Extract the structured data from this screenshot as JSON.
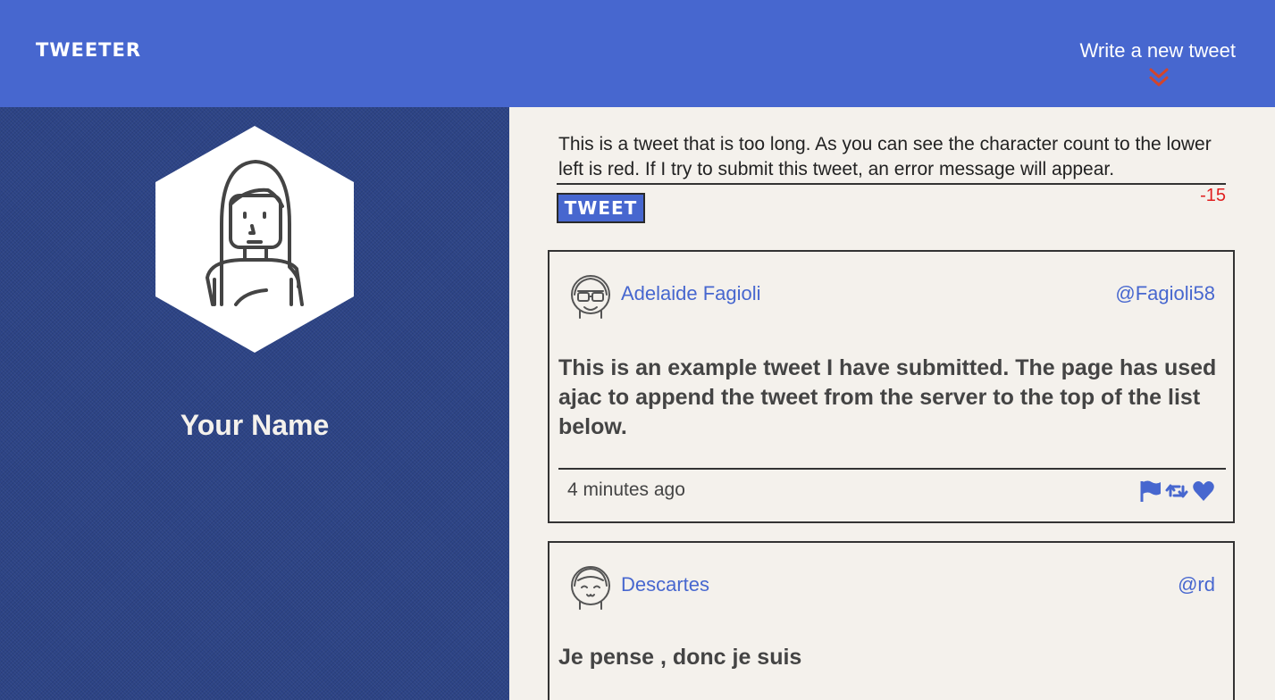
{
  "nav": {
    "brand": "TWEETER",
    "compose_link": "Write a new tweet",
    "compose_icon": "double-chevron-down-icon"
  },
  "profile": {
    "name": "Your Name",
    "avatar_icon": "user-avatar-icon"
  },
  "composer": {
    "text": "This is a tweet that is too long. As you can see the character count to the lower left is red. If I try to submit this tweet, an error message will appear.",
    "submit_label": "TWEET",
    "counter": "-15",
    "counter_color": "#e02020"
  },
  "tweets": [
    {
      "name": "Adelaide Fagioli",
      "handle": "@Fagioli58",
      "body": "This is an example tweet I have submitted. The page has used ajac to append the tweet from the server to the top of the list below.",
      "time": "4 minutes ago",
      "actions": [
        "flag-icon",
        "retweet-icon",
        "heart-icon"
      ]
    },
    {
      "name": "Descartes",
      "handle": "@rd",
      "body": "Je pense , donc je suis"
    }
  ],
  "colors": {
    "accent": "#4767cf",
    "profile_bg": "#2d4486",
    "page_bg": "#f4f1ec",
    "error": "#e02020"
  }
}
